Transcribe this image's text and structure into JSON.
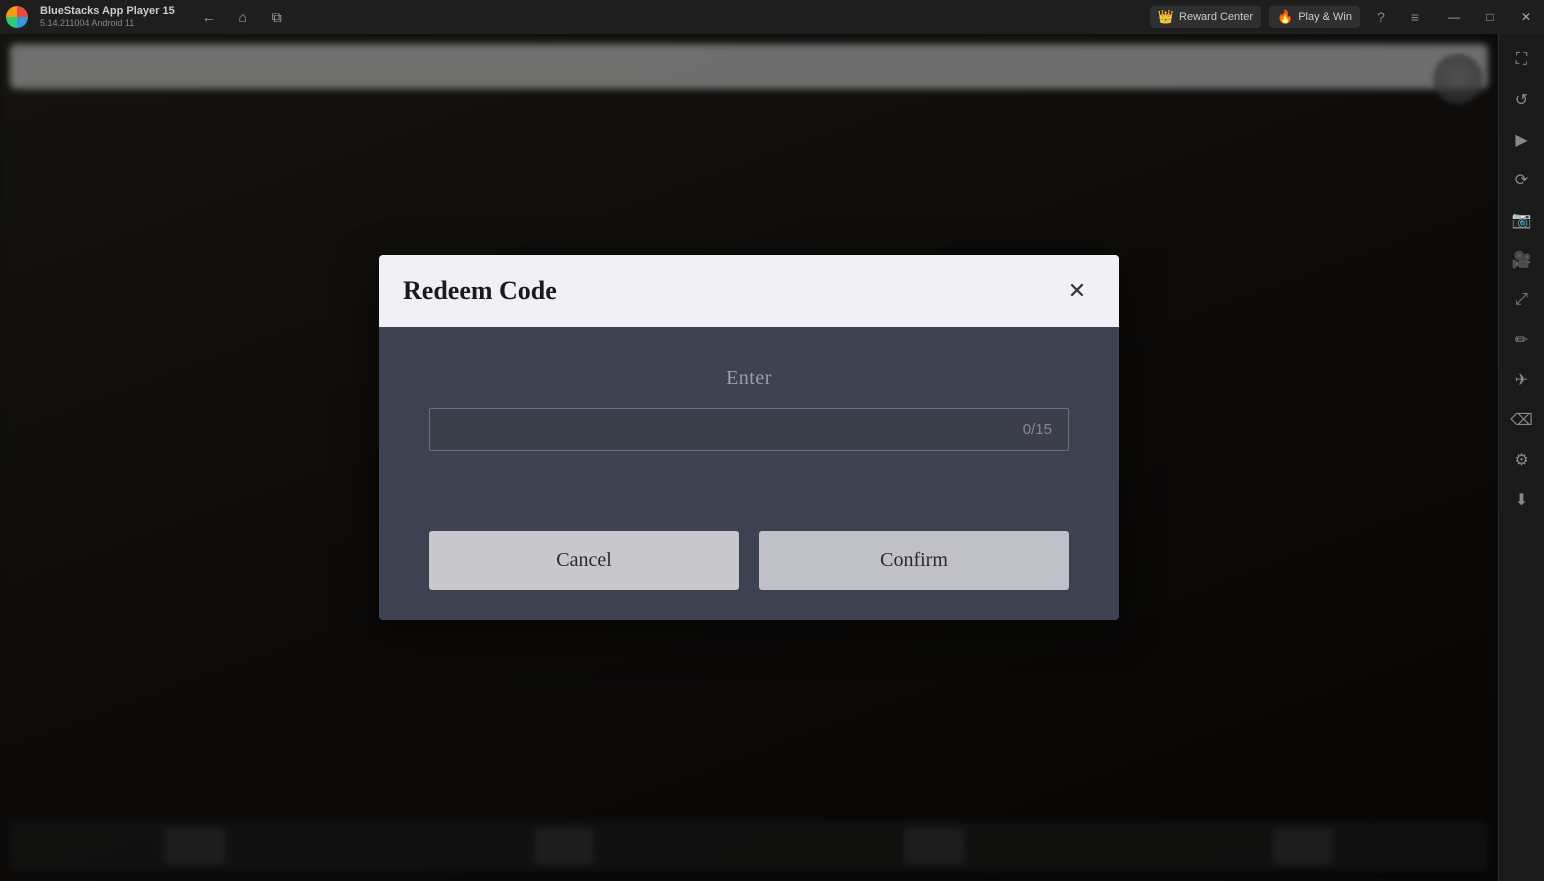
{
  "titlebar": {
    "app_name": "BlueStacks App Player 15",
    "app_version": "5.14.211004  Android 11",
    "nav": {
      "back_label": "←",
      "home_label": "⌂",
      "copy_label": "⧉"
    },
    "reward_center_label": "Reward Center",
    "play_win_label": "Play & Win",
    "help_label": "?",
    "menu_label": "≡",
    "minimize_label": "—",
    "maximize_label": "□",
    "close_label": "✕",
    "restore_label": "❐"
  },
  "sidebar": {
    "icons": [
      {
        "name": "expand-icon",
        "symbol": "⛶"
      },
      {
        "name": "rotate-icon",
        "symbol": "↺"
      },
      {
        "name": "play-icon",
        "symbol": "▶"
      },
      {
        "name": "refresh-icon",
        "symbol": "⟳"
      },
      {
        "name": "screenshot-icon",
        "symbol": "📷"
      },
      {
        "name": "camera-icon",
        "symbol": "🎥"
      },
      {
        "name": "fit-icon",
        "symbol": "⤢"
      },
      {
        "name": "edit-icon",
        "symbol": "✏"
      },
      {
        "name": "airplane-icon",
        "symbol": "✈"
      },
      {
        "name": "eraser-icon",
        "symbol": "⌫"
      },
      {
        "name": "settings-icon",
        "symbol": "⚙"
      },
      {
        "name": "download-icon",
        "symbol": "⬇"
      }
    ]
  },
  "dialog": {
    "title": "Redeem Code",
    "close_label": "✕",
    "enter_label": "Enter",
    "code_input_placeholder": "",
    "code_input_value": "",
    "code_counter": "0/15",
    "cancel_label": "Cancel",
    "confirm_label": "Confirm"
  }
}
